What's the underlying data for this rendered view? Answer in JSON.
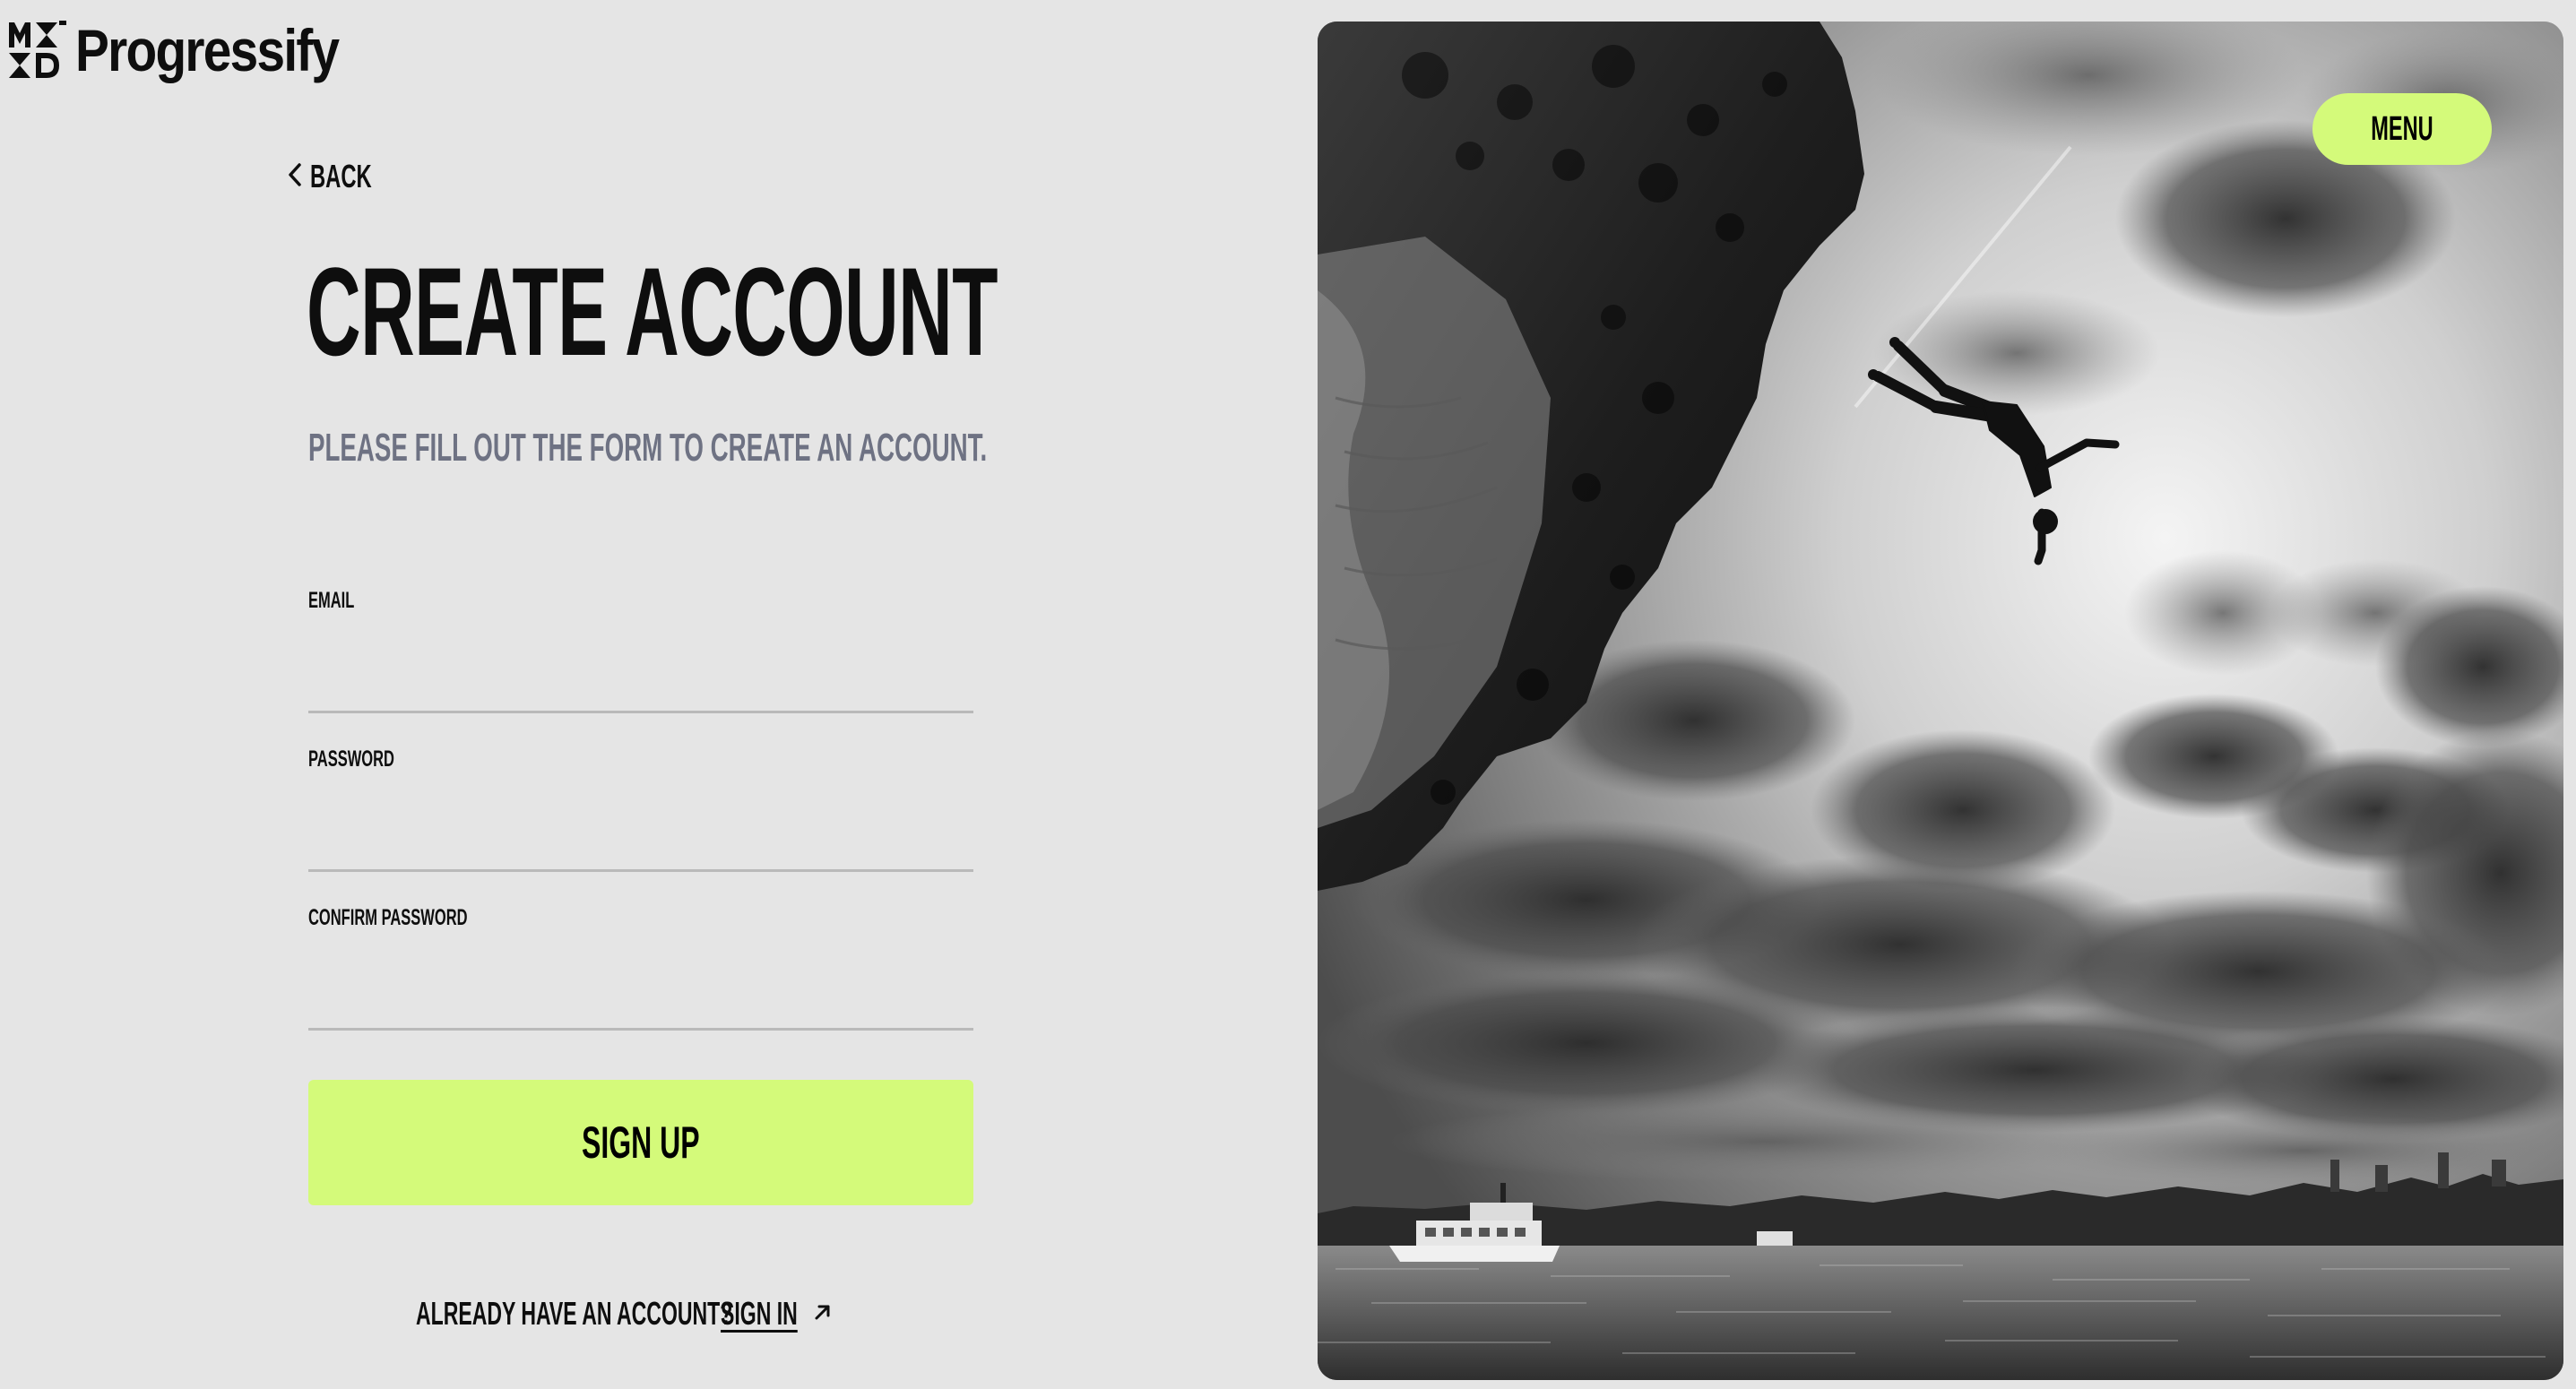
{
  "brand": {
    "logo_icon": "mdd-monogram-icon",
    "name": "Progressify"
  },
  "nav": {
    "back_label": "Back",
    "back_icon": "chevron-left-icon",
    "menu_label": "Menu"
  },
  "form": {
    "title": "Create Account",
    "subtitle": "Please fill out the form to create an account.",
    "fields": [
      {
        "label": "Email",
        "value": "",
        "type": "email"
      },
      {
        "label": "Password",
        "value": "",
        "type": "password"
      },
      {
        "label": "Confirm Password",
        "value": "",
        "type": "password"
      }
    ],
    "submit_label": "Sign Up"
  },
  "footer": {
    "question": "Already have an account?",
    "signin_label": "Sign In",
    "signin_icon": "arrow-up-right-icon"
  },
  "hero": {
    "image": "black-and-white photo of a person diving off a cliff toward the sea under a cloudy sky"
  },
  "colors": {
    "background": "#e5e5e5",
    "accent": "#d4fa7a",
    "text": "#0e0e0e",
    "muted": "#6e7283",
    "divider": "#b9b9b9"
  }
}
